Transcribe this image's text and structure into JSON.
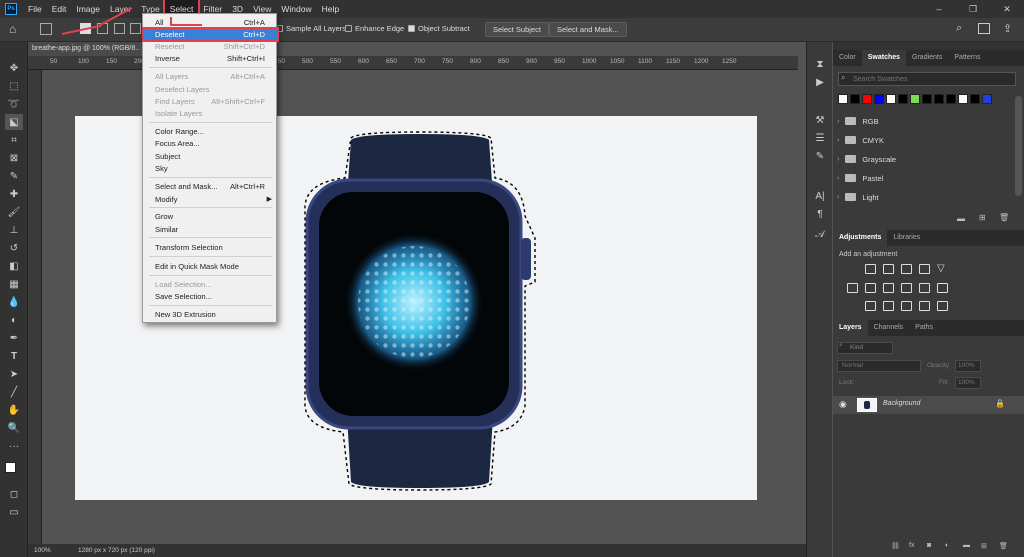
{
  "menubar": {
    "logo": "Ps",
    "items": [
      "File",
      "Edit",
      "Image",
      "Layer",
      "Type",
      "Select",
      "Filter",
      "3D",
      "View",
      "Window",
      "Help"
    ],
    "active_index": 5
  },
  "window_controls": [
    "–",
    "❐",
    "✕"
  ],
  "options": {
    "sample_all_layers": "Sample All Layers",
    "enhance_edge": "Enhance Edge",
    "object_subtract": "Object Subtract",
    "select_subject": "Select Subject",
    "select_and_mask": "Select and Mask..."
  },
  "document": {
    "tab_title": "breathe-app.jpg @ 100% (RGB/8...",
    "ruler_ticks": [
      "50",
      "100",
      "150",
      "200",
      "250",
      "300",
      "350",
      "400",
      "450",
      "500",
      "550",
      "600",
      "650",
      "700",
      "750",
      "800",
      "850",
      "900",
      "950",
      "1000",
      "1050",
      "1100",
      "1150",
      "1200",
      "1250"
    ],
    "zoom": "100%",
    "doc_info": "1280 px x 720 px (120 ppi)"
  },
  "select_menu": {
    "items": [
      {
        "label": "All",
        "shortcut": "Ctrl+A",
        "state": "normal"
      },
      {
        "label": "Deselect",
        "shortcut": "Ctrl+D",
        "state": "highlighted"
      },
      {
        "label": "Reselect",
        "shortcut": "Shift+Ctrl+D",
        "state": "disabled"
      },
      {
        "label": "Inverse",
        "shortcut": "Shift+Ctrl+I",
        "state": "normal"
      },
      {
        "label": "All Layers",
        "shortcut": "Alt+Ctrl+A",
        "state": "disabled"
      },
      {
        "label": "Deselect Layers",
        "shortcut": "",
        "state": "disabled"
      },
      {
        "label": "Find Layers",
        "shortcut": "Alt+Shift+Ctrl+F",
        "state": "disabled"
      },
      {
        "label": "Isolate Layers",
        "shortcut": "",
        "state": "disabled"
      },
      {
        "label": "Color Range...",
        "shortcut": "",
        "state": "normal"
      },
      {
        "label": "Focus Area...",
        "shortcut": "",
        "state": "normal"
      },
      {
        "label": "Subject",
        "shortcut": "",
        "state": "normal"
      },
      {
        "label": "Sky",
        "shortcut": "",
        "state": "normal"
      },
      {
        "label": "Select and Mask...",
        "shortcut": "Alt+Ctrl+R",
        "state": "normal"
      },
      {
        "label": "Modify",
        "shortcut": "",
        "state": "normal"
      },
      {
        "label": "Grow",
        "shortcut": "",
        "state": "normal"
      },
      {
        "label": "Similar",
        "shortcut": "",
        "state": "normal"
      },
      {
        "label": "Transform Selection",
        "shortcut": "",
        "state": "normal"
      },
      {
        "label": "Edit in Quick Mask Mode",
        "shortcut": "",
        "state": "normal"
      },
      {
        "label": "Load Selection...",
        "shortcut": "",
        "state": "disabled"
      },
      {
        "label": "Save Selection...",
        "shortcut": "",
        "state": "normal"
      },
      {
        "label": "New 3D Extrusion",
        "shortcut": "",
        "state": "normal"
      }
    ]
  },
  "swatches_panel": {
    "tabs": [
      "Color",
      "Swatches",
      "Gradients",
      "Patterns"
    ],
    "active_tab": "Swatches",
    "search_placeholder": "Search Swatches",
    "colors": [
      "#ffffff",
      "#000000",
      "#ff0000",
      "#0000ff",
      "#ffffff",
      "#000000",
      "#7ed957",
      "#000000",
      "#000000",
      "#000000",
      "#ffffff",
      "#000000",
      "#1f3fe0"
    ],
    "groups": [
      "RGB",
      "CMYK",
      "Grayscale",
      "Pastel",
      "Light"
    ]
  },
  "adjustments_panel": {
    "tabs": [
      "Adjustments",
      "Libraries"
    ],
    "active_tab": "Adjustments",
    "hint": "Add an adjustment"
  },
  "layers_panel": {
    "tabs": [
      "Layers",
      "Channels",
      "Paths"
    ],
    "active_tab": "Layers",
    "filter_label": "Kind",
    "blend_mode": "Normal",
    "opacity_label": "Opacity:",
    "opacity_value": "100%",
    "lock_label": "Lock:",
    "fill_label": "Fill:",
    "fill_value": "100%",
    "layers": [
      {
        "name": "Background",
        "locked": true
      }
    ]
  },
  "tools": [
    "move-tool",
    "marquee-tool",
    "lasso-tool",
    "object-selection-tool",
    "crop-tool",
    "frame-tool",
    "eyedropper-tool",
    "healing-tool",
    "brush-tool",
    "stamp-tool",
    "history-brush-tool",
    "eraser-tool",
    "gradient-tool",
    "blur-tool",
    "dodge-tool",
    "pen-tool",
    "type-tool",
    "path-selection-tool",
    "rectangle-tool",
    "hand-tool",
    "zoom-tool",
    "more-tools"
  ]
}
